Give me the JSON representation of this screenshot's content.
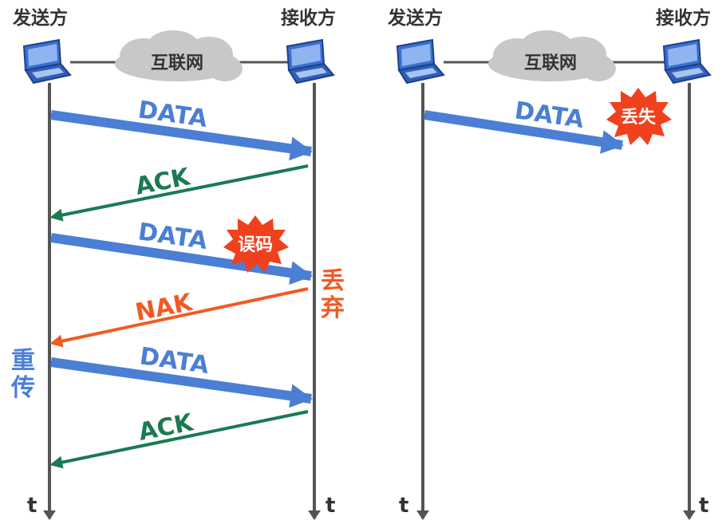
{
  "colors": {
    "data_blue": "#4a7fd4",
    "ack_green": "#1a7a52",
    "nak_orange": "#f25a22",
    "label_blue": "#4a7fd4",
    "badge_red": "#f0401e",
    "cloud_gray": "#c8c8c8",
    "line_gray": "#555555",
    "laptop_blue": "#3a6fd0"
  },
  "left": {
    "sender": "发送方",
    "receiver": "接收方",
    "network": "互联网",
    "time_left": "t",
    "time_right": "t",
    "messages": [
      {
        "label": "DATA",
        "kind": "data"
      },
      {
        "label": "ACK",
        "kind": "ack"
      },
      {
        "label": "DATA",
        "kind": "data"
      },
      {
        "label": "NAK",
        "kind": "nak"
      },
      {
        "label": "DATA",
        "kind": "data"
      },
      {
        "label": "ACK",
        "kind": "ack"
      }
    ],
    "error_badge": "误码",
    "discard_1": "丢",
    "discard_2": "弃",
    "retransmit_1": "重",
    "retransmit_2": "传"
  },
  "right": {
    "sender": "发送方",
    "receiver": "接收方",
    "network": "互联网",
    "time_left": "t",
    "time_right": "t",
    "message": "DATA",
    "lost_badge": "丢失"
  },
  "icons": [
    "laptop-icon",
    "cloud-icon",
    "explosion-badge-icon"
  ]
}
